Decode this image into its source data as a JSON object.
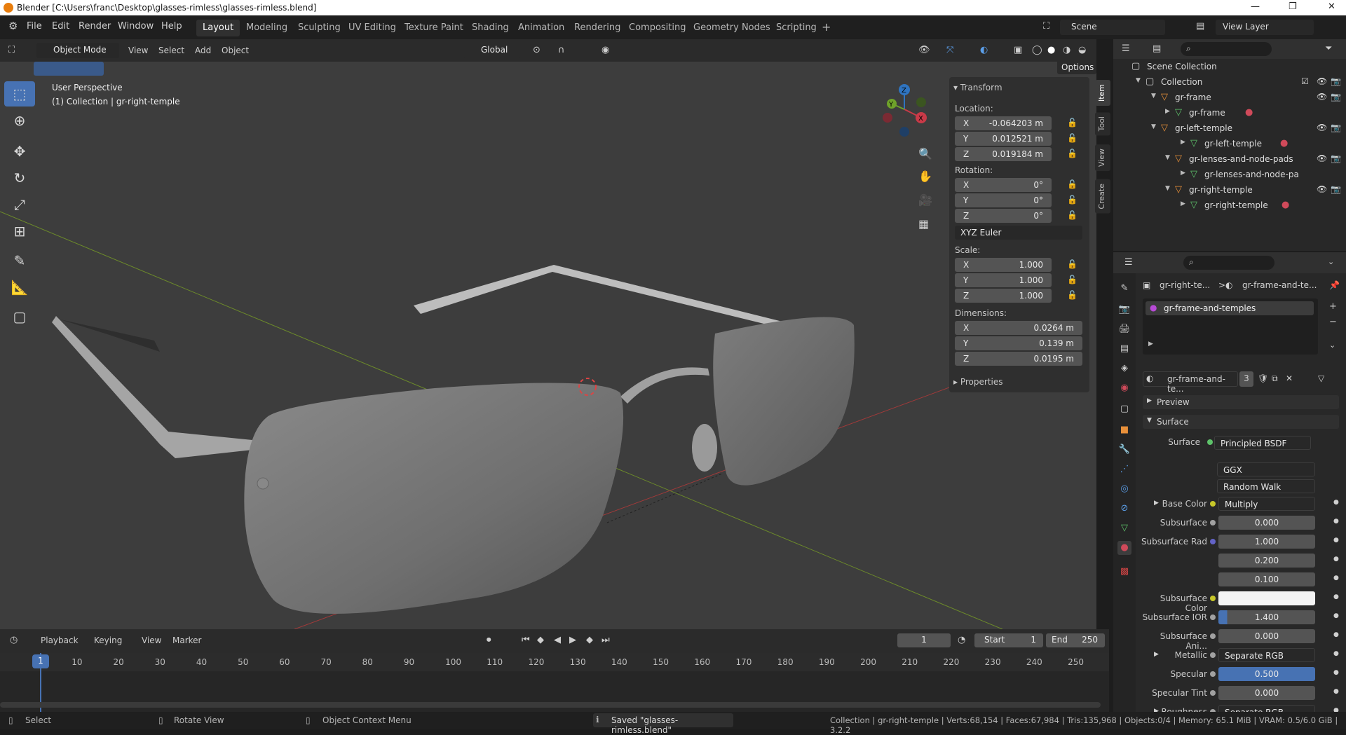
{
  "window": {
    "title": "Blender [C:\\Users\\franc\\Desktop\\glasses-rimless\\glasses-rimless.blend]",
    "minimize": "—",
    "maximize": "❐",
    "close": "✕"
  },
  "menu": {
    "items": [
      "File",
      "Edit",
      "Render",
      "Window",
      "Help"
    ]
  },
  "workspaces": {
    "tabs": [
      "Layout",
      "Modeling",
      "Sculpting",
      "UV Editing",
      "Texture Paint",
      "Shading",
      "Animation",
      "Rendering",
      "Compositing",
      "Geometry Nodes",
      "Scripting"
    ],
    "active": "Layout",
    "add": "+"
  },
  "scene": {
    "label": "Scene",
    "view_layer": "View Layer"
  },
  "viewport_header": {
    "mode": "Object Mode",
    "menus": [
      "View",
      "Select",
      "Add",
      "Object"
    ],
    "transform": "Global",
    "options": "Options"
  },
  "viewport": {
    "perspective": "User Perspective",
    "context": "(1) Collection | gr-right-temple"
  },
  "gizmo": {
    "x": "X",
    "y": "Y",
    "z": "Z"
  },
  "npanel": {
    "title": "Transform",
    "location_label": "Location:",
    "location": [
      {
        "axis": "X",
        "value": "-0.064203 m"
      },
      {
        "axis": "Y",
        "value": "0.012521 m"
      },
      {
        "axis": "Z",
        "value": "0.019184 m"
      }
    ],
    "rotation_label": "Rotation:",
    "rotation": [
      {
        "axis": "X",
        "value": "0°"
      },
      {
        "axis": "Y",
        "value": "0°"
      },
      {
        "axis": "Z",
        "value": "0°"
      }
    ],
    "rotation_mode": "XYZ Euler",
    "scale_label": "Scale:",
    "scale": [
      {
        "axis": "X",
        "value": "1.000"
      },
      {
        "axis": "Y",
        "value": "1.000"
      },
      {
        "axis": "Z",
        "value": "1.000"
      }
    ],
    "dimensions_label": "Dimensions:",
    "dimensions": [
      {
        "axis": "X",
        "value": "0.0264 m"
      },
      {
        "axis": "Y",
        "value": "0.139 m"
      },
      {
        "axis": "Z",
        "value": "0.0195 m"
      }
    ],
    "properties": "Properties",
    "tabs": [
      "Item",
      "Tool",
      "View",
      "Create"
    ]
  },
  "outliner": {
    "rows": [
      {
        "label": "Scene Collection",
        "depth": 0
      },
      {
        "label": "Collection",
        "depth": 1
      },
      {
        "label": "gr-frame",
        "depth": 2
      },
      {
        "label": "gr-frame",
        "depth": 3
      },
      {
        "label": "gr-left-temple",
        "depth": 2
      },
      {
        "label": "gr-left-temple",
        "depth": 3
      },
      {
        "label": "gr-lenses-and-node-pads",
        "depth": 2
      },
      {
        "label": "gr-lenses-and-node-pa",
        "depth": 3
      },
      {
        "label": "gr-right-temple",
        "depth": 2
      },
      {
        "label": "gr-right-temple",
        "depth": 3
      }
    ]
  },
  "properties": {
    "breadcrumb_object": "gr-right-te...",
    "breadcrumb_material": "gr-frame-and-te...",
    "material_slot": "gr-frame-and-temples",
    "material_name": "gr-frame-and-te...",
    "users": "3",
    "sections": {
      "preview": "Preview",
      "surface": "Surface"
    },
    "surface_label": "Surface",
    "surface_value": "Principled BSDF",
    "distribution": "GGX",
    "subsurface_method": "Random Walk",
    "rows": [
      {
        "label": "Base Color",
        "value": "Multiply",
        "kind": "link",
        "dot": "#c7c729"
      },
      {
        "label": "Subsurface",
        "value": "0.000",
        "kind": "num",
        "dot": "#a1a1a1"
      },
      {
        "label": "Subsurface Rad",
        "value": "1.000",
        "kind": "num",
        "dot": "#6363c7"
      },
      {
        "label": "",
        "value": "0.200",
        "kind": "num",
        "dot": ""
      },
      {
        "label": "",
        "value": "0.100",
        "kind": "num",
        "dot": ""
      },
      {
        "label": "Subsurface Color",
        "value": "",
        "kind": "color",
        "dot": "#c7c729"
      },
      {
        "label": "Subsurface IOR",
        "value": "1.400",
        "kind": "num",
        "dot": "#a1a1a1"
      },
      {
        "label": "Subsurface Ani...",
        "value": "0.000",
        "kind": "num",
        "dot": "#a1a1a1"
      },
      {
        "label": "Metallic",
        "value": "Separate RGB",
        "kind": "link",
        "dot": "#a1a1a1"
      },
      {
        "label": "Specular",
        "value": "0.500",
        "kind": "bar",
        "dot": "#a1a1a1"
      },
      {
        "label": "Specular Tint",
        "value": "0.000",
        "kind": "num",
        "dot": "#a1a1a1"
      },
      {
        "label": "Roughness",
        "value": "Separate RGB",
        "kind": "link",
        "dot": "#a1a1a1"
      }
    ]
  },
  "timeline": {
    "menus": [
      "Playback",
      "Keying",
      "View",
      "Marker"
    ],
    "current_frame": "1",
    "start_label": "Start",
    "start": "1",
    "end_label": "End",
    "end": "250",
    "ticks": [
      "1",
      "10",
      "20",
      "30",
      "40",
      "50",
      "60",
      "70",
      "80",
      "90",
      "100",
      "110",
      "120",
      "130",
      "140",
      "150",
      "160",
      "170",
      "180",
      "190",
      "200",
      "210",
      "220",
      "230",
      "240",
      "250"
    ]
  },
  "status": {
    "select": "Select",
    "rotate": "Rotate View",
    "context": "Object Context Menu",
    "saved": "Saved \"glasses-rimless.blend\"",
    "stats": "Collection | gr-right-temple | Verts:68,154 | Faces:67,984 | Tris:135,968 | Objects:0/4 | Memory: 65.1 MiB | VRAM: 0.5/6.0 GiB | 3.2.2"
  }
}
